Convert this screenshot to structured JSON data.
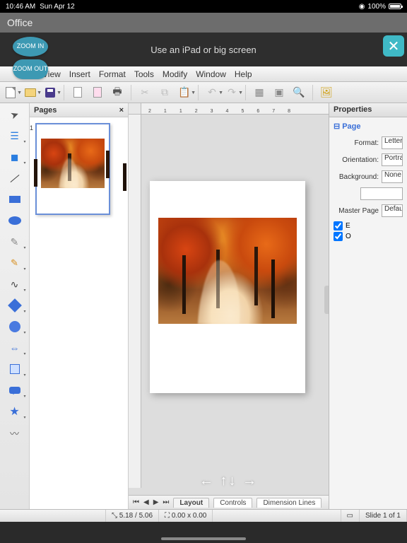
{
  "status": {
    "time": "10:46 AM",
    "date": "Sun Apr 12",
    "battery": "100%"
  },
  "title": "Office",
  "hint": "Use an iPad or big screen",
  "zoom": {
    "in": "ZOOM IN",
    "out": "ZOOM OUT"
  },
  "close_glyph": "✕",
  "menu": {
    "view": "View",
    "insert": "Insert",
    "format": "Format",
    "tools": "Tools",
    "modify": "Modify",
    "window": "Window",
    "help": "Help"
  },
  "pages_panel": {
    "title": "Pages",
    "close": "×",
    "thumb_num": "1"
  },
  "ruler": {
    "m2": "2",
    "m1": "1",
    "p1": "1",
    "p2": "2",
    "p3": "3",
    "p4": "4",
    "p5": "5",
    "p6": "6",
    "p7": "7",
    "p8": "8"
  },
  "tabs": {
    "layout": "Layout",
    "controls": "Controls",
    "dimension": "Dimension Lines"
  },
  "nav": {
    "first": "⏮",
    "prev": "◀",
    "next": "▶",
    "last": "⏭"
  },
  "props": {
    "title": "Properties",
    "section": "Page",
    "format_label": "Format:",
    "format_val": "Letter",
    "orient_label": "Orientation:",
    "orient_val": "Portrait",
    "bg_label": "Background:",
    "bg_val": "None",
    "master_label": "Master Page",
    "master_val": "Default",
    "chk1": "E",
    "chk2": "O"
  },
  "statusbar": {
    "coords": "5.18 / 5.06",
    "size": "0.00 x 0.00",
    "slide": "Slide 1 of 1"
  },
  "overlay_arrows": "←  ↑↓  →"
}
